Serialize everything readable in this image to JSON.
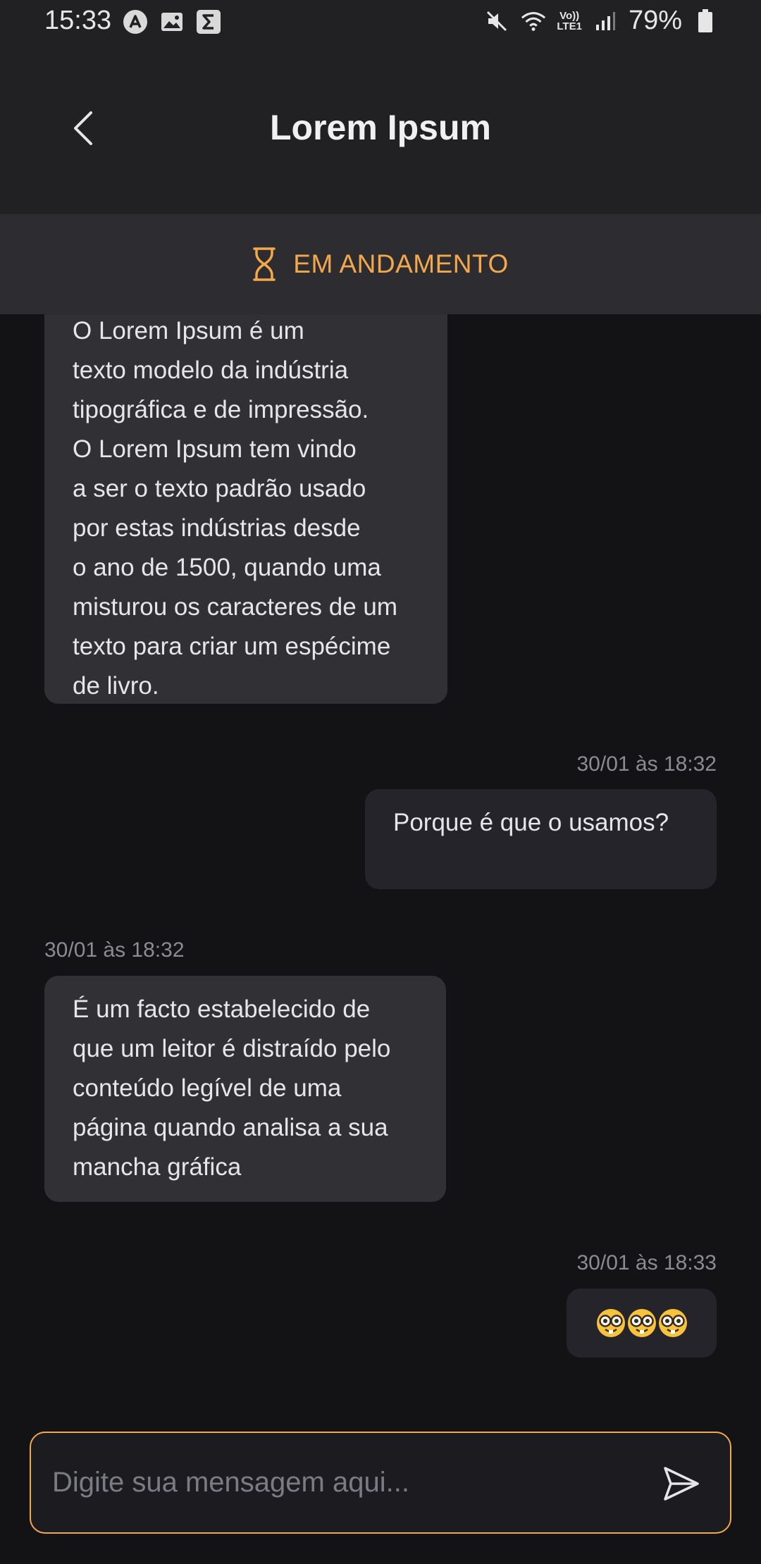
{
  "status_bar": {
    "time": "15:33",
    "battery": "79%",
    "volte_top": "Vo))",
    "volte_bottom": "LTE1",
    "icons": [
      "a-circle-icon",
      "gallery-icon",
      "sigma-icon",
      "mute-icon",
      "wifi-icon",
      "volte-icon",
      "signal-icon",
      "battery-icon"
    ]
  },
  "header": {
    "title": "Lorem Ipsum",
    "back_icon": "chevron-left-icon"
  },
  "status": {
    "label": "EM ANDAMENTO",
    "icon": "hourglass-icon",
    "color": "#f3a84c"
  },
  "messages": [
    {
      "direction": "in",
      "lines": [
        "O Lorem Ipsum é um",
        "texto modelo da indústria",
        "tipográfica e de impressão.",
        "O Lorem Ipsum tem vindo",
        "a ser o texto padrão usado",
        "por estas indústrias desde",
        "o ano de 1500, quando uma",
        "misturou os caracteres de um",
        "texto para criar um espécime",
        "de livro."
      ]
    },
    {
      "direction": "out",
      "timestamp": "30/01 às 18:32",
      "text": "Porque é que o usamos?"
    },
    {
      "direction": "in",
      "timestamp": "30/01 às 18:32",
      "lines": [
        "É um facto estabelecido de",
        "que um leitor é distraído pelo",
        "conteúdo legível de uma",
        "página quando analisa a sua",
        "mancha gráfica"
      ]
    },
    {
      "direction": "out",
      "timestamp": "30/01 às 18:33",
      "emoji": [
        "nerd-face",
        "nerd-face",
        "nerd-face"
      ]
    }
  ],
  "composer": {
    "placeholder": "Digite sua mensagem aqui...",
    "send_icon": "send-icon"
  },
  "colors": {
    "accent": "#f3a84c",
    "background": "#131316",
    "header": "#212124",
    "bubble_in": "#303035",
    "bubble_out": "#24242a"
  }
}
